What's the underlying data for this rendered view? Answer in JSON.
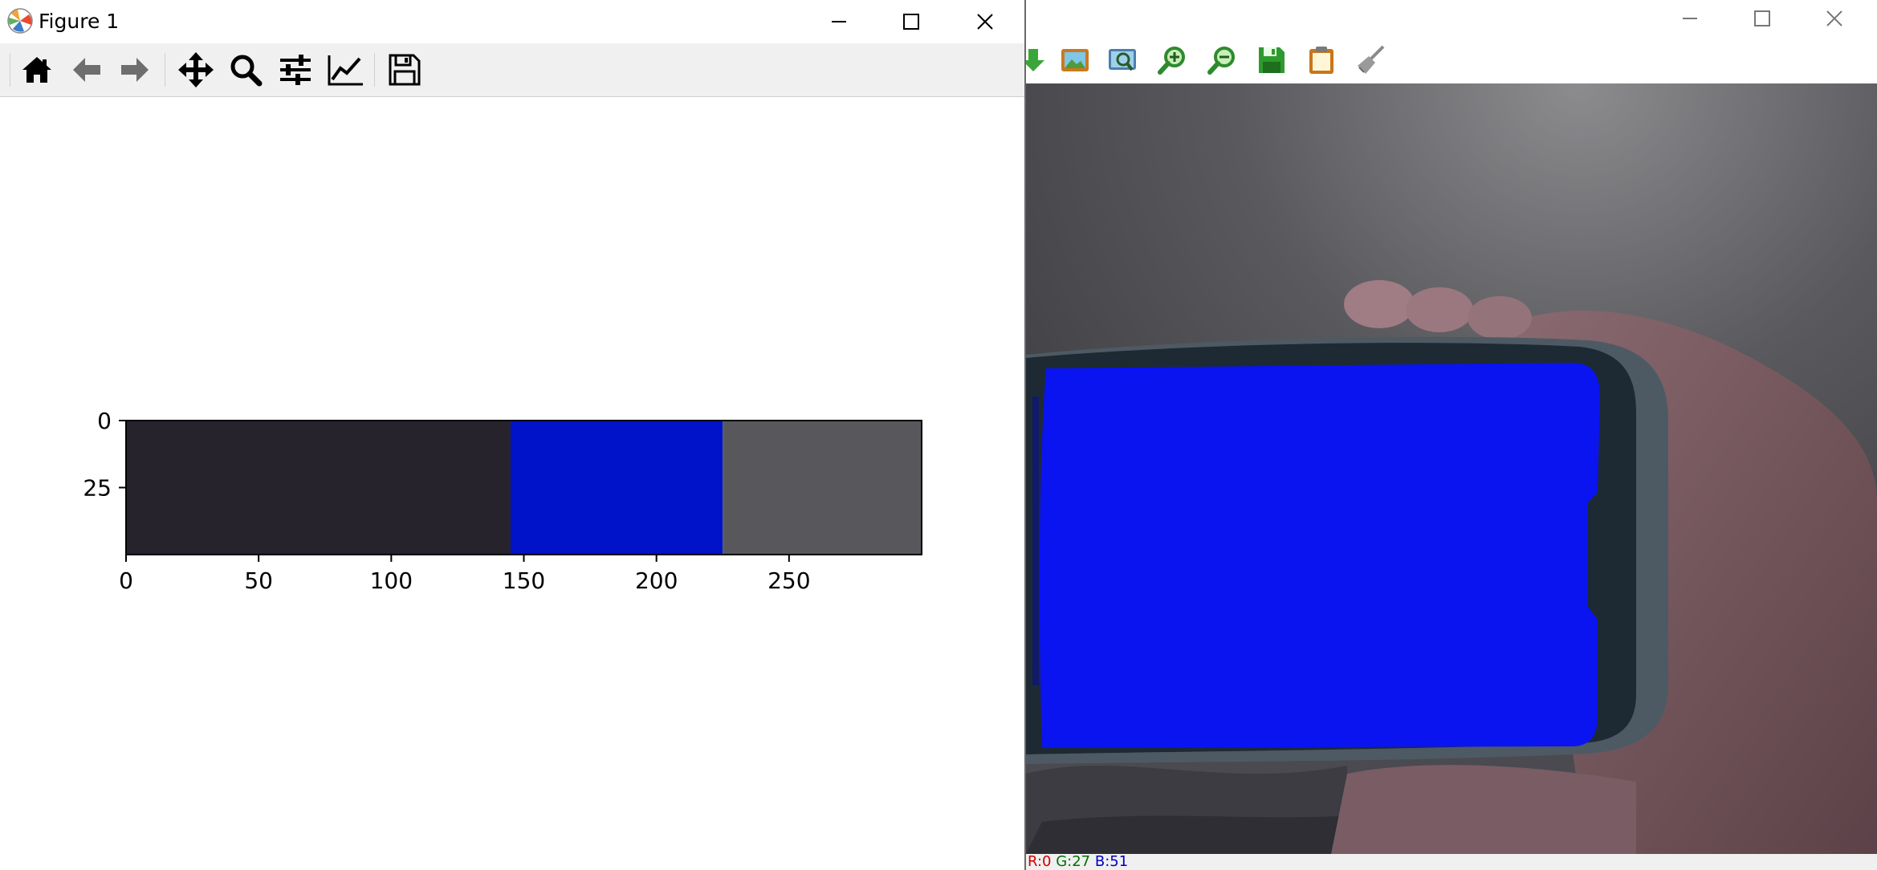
{
  "mpl_window": {
    "title": "Figure 1",
    "toolbar": {
      "buttons": [
        "home-icon",
        "back-icon",
        "forward-icon",
        "pan-icon",
        "zoom-icon",
        "configure-subplots-icon",
        "edit-axis-icon",
        "save-icon"
      ]
    }
  },
  "chart_data": {
    "type": "heatmap",
    "segments": [
      {
        "x_start": 0,
        "x_end": 145,
        "color": "#26232c"
      },
      {
        "x_start": 145,
        "x_end": 225,
        "color": "#0013c8"
      },
      {
        "x_start": 225,
        "x_end": 300,
        "color": "#58585c"
      }
    ],
    "xlim": [
      0,
      300
    ],
    "ylim": [
      50,
      0
    ],
    "xticks": [
      0,
      50,
      100,
      150,
      200,
      250
    ],
    "xtick_labels": [
      "0",
      "50",
      "100",
      "150",
      "200",
      "250"
    ],
    "yticks": [
      0,
      25
    ],
    "ytick_labels": [
      "0",
      "25"
    ],
    "title": "",
    "xlabel": "",
    "ylabel": "",
    "grid": false
  },
  "viewer_window": {
    "toolbar": {
      "buttons": [
        "download-icon",
        "image-icon",
        "zoom-region-icon",
        "zoom-in-icon",
        "zoom-out-icon",
        "save-icon",
        "clipboard-icon",
        "clear-icon"
      ]
    },
    "status": {
      "r": "R:0",
      "g": "G:27",
      "b": "B:51"
    }
  }
}
